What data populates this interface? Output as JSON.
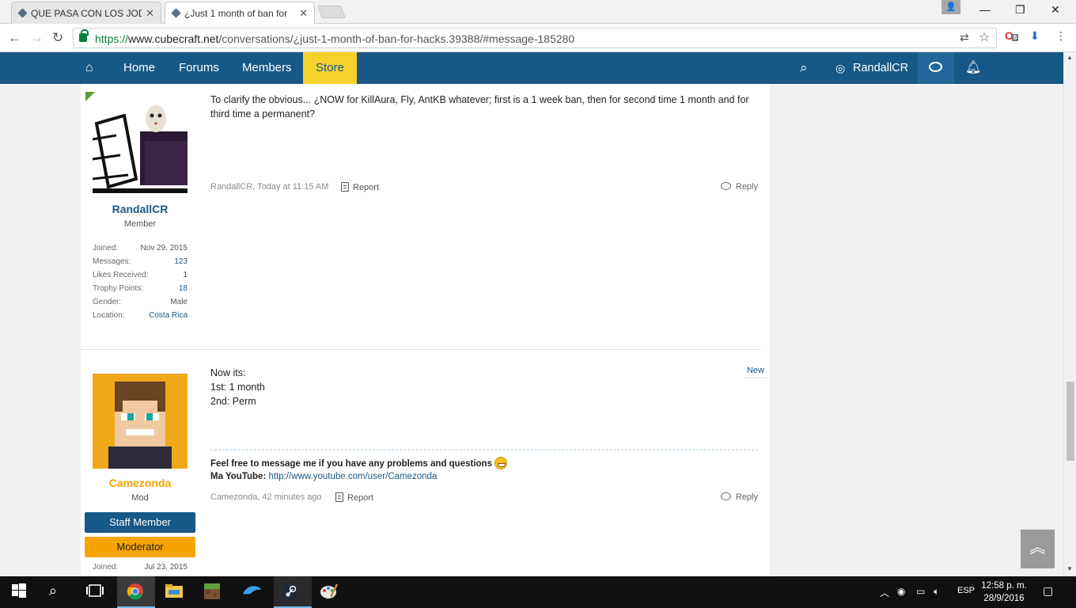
{
  "browser": {
    "tabs": [
      {
        "title": "QUE PASA CON LOS JOD"
      },
      {
        "title": "¿Just 1 month of ban for"
      }
    ],
    "url_scheme": "https://",
    "url_host": "www.cubecraft.net",
    "url_path": "/conversations/¿just-1-month-of-ban-for-hacks.39388/#message-185280",
    "ext_badge": "6"
  },
  "nav": {
    "home": "Home",
    "forums": "Forums",
    "members": "Members",
    "store": "Store",
    "user": "RandallCR"
  },
  "messages": [
    {
      "author": "RandallCR",
      "user_title": "Member",
      "stats": [
        {
          "label": "Joined:",
          "value": "Nov 29, 2015"
        },
        {
          "label": "Messages:",
          "value": "123"
        },
        {
          "label": "Likes Received:",
          "value": "1"
        },
        {
          "label": "Trophy Points:",
          "value": "18"
        },
        {
          "label": "Gender:",
          "value": "Male"
        },
        {
          "label": "Location:",
          "value": "Costa Rica"
        }
      ],
      "body": "To clarify the obvious... ¿NOW for KillAura, Fly, AntKB whatever; first is a 1 week ban, then for second time 1 month and for third time a permanent?",
      "meta": "RandallCR, Today at 11:15 AM",
      "report": "Report",
      "reply": "Reply"
    },
    {
      "author": "Camezonda",
      "user_title": "Mod",
      "banners": [
        "Staff Member",
        "Moderator"
      ],
      "stats": [
        {
          "label": "Joined:",
          "value": "Jul 23, 2015"
        }
      ],
      "badge": "New",
      "body_lines": [
        "Now its:",
        "1st: 1 month",
        "2nd: Perm"
      ],
      "signature_line": "Feel free to message me if you have any problems and questions",
      "signature_prefix": "Ma YouTube:",
      "signature_link": "http://www.youtube.com/user/Camezonda",
      "meta": "Camezonda, 42 minutes ago",
      "report": "Report",
      "reply": "Reply"
    }
  ],
  "taskbar": {
    "lang": "ESP",
    "time": "12:58 p. m.",
    "date": "28/9/2016"
  },
  "colors": {
    "brand": "#185886",
    "store": "#f5d22b",
    "staff": "#185886",
    "moderator": "#f5a300",
    "mod_name": "#f5a300"
  }
}
